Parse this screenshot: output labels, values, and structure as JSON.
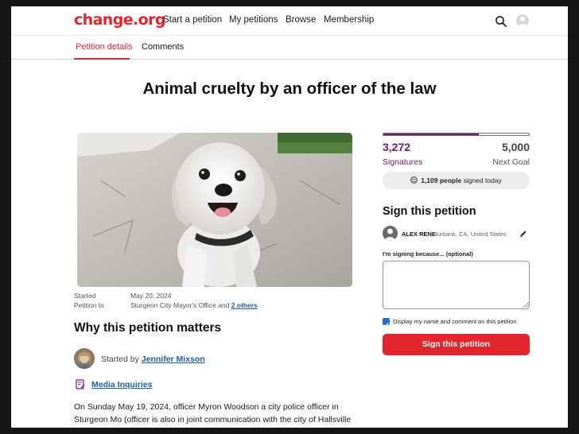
{
  "nav": {
    "logo": "change.org",
    "items": [
      "Start a petition",
      "My petitions",
      "Browse",
      "Membership"
    ],
    "search_icon": "search-icon",
    "avatar_icon": "user-avatar-icon"
  },
  "subnav": {
    "tabs": [
      "Petition details",
      "Comments"
    ],
    "active_tab": "Petition details"
  },
  "petition": {
    "title": "Animal cruelty by an officer of the law",
    "started_label": "Started",
    "started_value": "May 20, 2024",
    "petition_to_label": "Petition to",
    "petition_to_value": "Sturgeon City Mayor's Office and",
    "petition_to_more": "2 others",
    "why_heading": "Why this petition matters",
    "started_by_prefix": "Started by",
    "starter_name": "Jennifer Mixson",
    "media_link": "Media Inquiries",
    "story_line1": "On Sunday May 19, 2024, officer Myron Woodson a city police officer in",
    "story_line2": "Sturgeon Mo (officer is also in joint communication with the city of Hallsville"
  },
  "signatures": {
    "count_text": "3,272",
    "count_label": "Signatures",
    "goal_text": "5,000",
    "goal_label": "Next Goal",
    "progress_fraction": 0.6544,
    "today_count": "1,109 people",
    "today_suffix": "signed today"
  },
  "sign_form": {
    "heading": "Sign this petition",
    "user_name": "ALEX RENE",
    "user_location": "Burbank, CA, United States",
    "reason_label": "I'm signing because... (optional)",
    "reason_value": "",
    "display_checkbox_label": "Display my name and comment on this petition",
    "display_checked": true,
    "submit_label": "Sign this petition"
  },
  "colors": {
    "brand_red": "#e3262e",
    "signature_purple": "#6d1a73",
    "link_blue": "#1c5fa8"
  }
}
